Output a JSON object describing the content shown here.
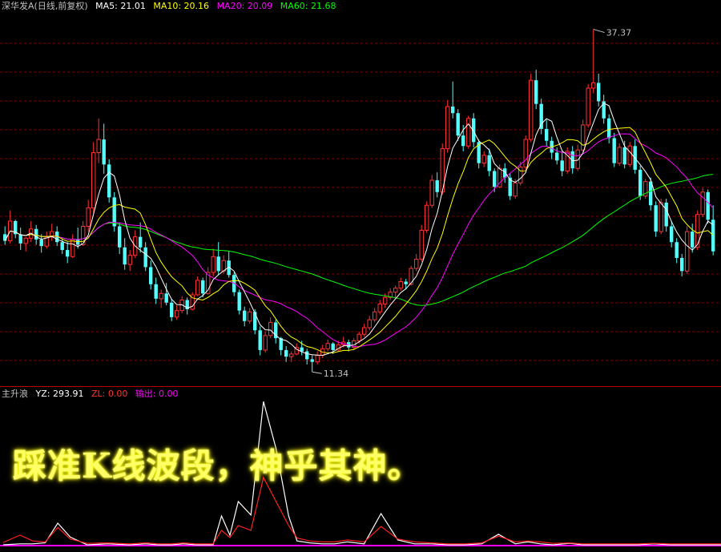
{
  "header": {
    "stock_name": "深华发A",
    "period_label": "(日线,前复权)",
    "ma5": "MA5: 21.01",
    "ma10": "MA10: 20.16",
    "ma20": "MA20: 20.09",
    "ma60": "MA60: 21.68"
  },
  "indicator_header": {
    "name": "主升浪",
    "yz": "YZ: 293.91",
    "zl": "ZL: 0.00",
    "out": "输出: 0.00"
  },
  "caption": "踩准K线波段，神乎其神。",
  "colors": {
    "up": "#ff3232",
    "down": "#54fcfc",
    "ma5": "#ffffff",
    "ma10": "#ffff00",
    "ma20": "#ff00ff",
    "ma60": "#00ff00",
    "grid": "#7a0000",
    "separator": "#b40000",
    "text": "#c0c0c0"
  },
  "chart_data": [
    {
      "type": "candlestick",
      "title": "深华发A (日线,前复权)",
      "price_range": [
        10.5,
        38.5
      ],
      "annotations": {
        "high": "37.37",
        "low": "11.34"
      },
      "candles": [
        [
          21.8,
          22.4,
          21.0,
          21.3
        ],
        [
          21.3,
          23.6,
          21.1,
          22.8
        ],
        [
          22.8,
          22.9,
          21.5,
          21.8
        ],
        [
          21.8,
          22.3,
          20.6,
          21.1
        ],
        [
          21.1,
          21.6,
          20.5,
          21.5
        ],
        [
          21.5,
          22.8,
          21.2,
          22.2
        ],
        [
          22.2,
          22.5,
          21.0,
          21.4
        ],
        [
          21.4,
          21.8,
          20.4,
          20.9
        ],
        [
          20.9,
          22.0,
          20.7,
          21.6
        ],
        [
          21.6,
          22.6,
          21.3,
          22.0
        ],
        [
          22.0,
          22.4,
          20.9,
          21.2
        ],
        [
          21.2,
          21.5,
          20.3,
          20.6
        ],
        [
          20.6,
          21.2,
          19.6,
          20.1
        ],
        [
          20.1,
          21.8,
          20.0,
          21.4
        ],
        [
          21.4,
          22.3,
          20.7,
          21.0
        ],
        [
          21.0,
          22.8,
          20.9,
          22.4
        ],
        [
          22.4,
          24.4,
          22.0,
          23.8
        ],
        [
          23.8,
          28.8,
          23.4,
          28.0
        ],
        [
          28.0,
          30.6,
          27.2,
          29.0
        ],
        [
          29.0,
          30.2,
          26.4,
          27.1
        ],
        [
          27.1,
          27.5,
          24.2,
          24.6
        ],
        [
          24.6,
          25.0,
          22.0,
          22.4
        ],
        [
          22.4,
          22.7,
          20.3,
          20.8
        ],
        [
          20.8,
          21.5,
          19.1,
          19.5
        ],
        [
          19.5,
          20.6,
          19.0,
          20.2
        ],
        [
          20.2,
          22.1,
          20.0,
          21.6
        ],
        [
          21.6,
          22.7,
          20.4,
          20.8
        ],
        [
          20.8,
          21.2,
          19.0,
          19.3
        ],
        [
          19.3,
          19.8,
          17.6,
          18.0
        ],
        [
          18.0,
          18.5,
          16.5,
          16.9
        ],
        [
          16.9,
          17.6,
          16.2,
          17.3
        ],
        [
          17.3,
          18.1,
          16.4,
          16.6
        ],
        [
          16.6,
          16.9,
          15.2,
          15.5
        ],
        [
          15.5,
          16.4,
          15.3,
          16.0
        ],
        [
          16.0,
          17.1,
          15.8,
          16.8
        ],
        [
          16.8,
          17.0,
          15.7,
          16.1
        ],
        [
          16.1,
          17.4,
          16.0,
          17.2
        ],
        [
          17.2,
          18.6,
          17.1,
          18.3
        ],
        [
          18.3,
          18.5,
          17.0,
          17.3
        ],
        [
          17.3,
          19.3,
          17.2,
          18.9
        ],
        [
          18.9,
          20.7,
          18.6,
          20.1
        ],
        [
          20.1,
          21.2,
          18.7,
          19.0
        ],
        [
          19.0,
          20.2,
          18.8,
          19.8
        ],
        [
          19.8,
          20.5,
          18.5,
          18.7
        ],
        [
          18.7,
          18.9,
          17.1,
          17.4
        ],
        [
          17.4,
          17.6,
          15.7,
          16.0
        ],
        [
          16.0,
          16.3,
          14.8,
          15.2
        ],
        [
          15.2,
          16.2,
          15.0,
          15.9
        ],
        [
          15.9,
          16.1,
          14.2,
          14.5
        ],
        [
          14.5,
          14.8,
          12.6,
          13.0
        ],
        [
          13.0,
          14.4,
          12.8,
          14.1
        ],
        [
          14.1,
          15.5,
          13.9,
          15.1
        ],
        [
          15.1,
          15.3,
          13.5,
          13.9
        ],
        [
          13.9,
          14.0,
          12.6,
          13.0
        ],
        [
          13.0,
          13.3,
          12.1,
          12.5
        ],
        [
          12.5,
          12.9,
          12.1,
          12.7
        ],
        [
          12.7,
          13.5,
          12.6,
          13.2
        ],
        [
          13.2,
          13.7,
          12.6,
          12.9
        ],
        [
          12.9,
          13.1,
          11.9,
          12.3
        ],
        [
          12.3,
          12.6,
          11.34,
          12.1
        ],
        [
          12.1,
          12.9,
          11.9,
          12.6
        ],
        [
          12.6,
          13.4,
          12.4,
          13.1
        ],
        [
          13.1,
          13.8,
          12.9,
          13.5
        ],
        [
          13.5,
          13.6,
          12.7,
          13.0
        ],
        [
          13.0,
          13.7,
          12.9,
          13.4
        ],
        [
          13.4,
          14.0,
          13.2,
          13.6
        ],
        [
          13.6,
          13.8,
          12.9,
          13.2
        ],
        [
          13.2,
          13.9,
          13.0,
          13.7
        ],
        [
          13.7,
          14.4,
          13.5,
          14.2
        ],
        [
          14.2,
          15.0,
          14.0,
          14.7
        ],
        [
          14.7,
          15.6,
          14.5,
          15.3
        ],
        [
          15.3,
          16.2,
          15.1,
          15.9
        ],
        [
          15.9,
          16.8,
          15.7,
          16.5
        ],
        [
          16.5,
          17.3,
          16.2,
          17.0
        ],
        [
          17.0,
          17.7,
          16.8,
          17.4
        ],
        [
          17.4,
          17.9,
          17.0,
          17.7
        ],
        [
          17.7,
          18.5,
          17.5,
          18.2
        ],
        [
          18.2,
          18.4,
          17.6,
          18.0
        ],
        [
          18.0,
          19.4,
          17.9,
          19.2
        ],
        [
          19.2,
          20.3,
          19.0,
          19.9
        ],
        [
          19.9,
          22.5,
          19.7,
          22.1
        ],
        [
          22.1,
          24.3,
          21.9,
          24.0
        ],
        [
          24.0,
          26.3,
          23.8,
          25.9
        ],
        [
          25.9,
          26.5,
          24.6,
          25.0
        ],
        [
          25.0,
          28.7,
          24.8,
          28.3
        ],
        [
          28.3,
          32.0,
          28.0,
          31.5
        ],
        [
          31.5,
          33.4,
          30.6,
          31.0
        ],
        [
          31.0,
          31.3,
          28.9,
          29.3
        ],
        [
          29.3,
          30.1,
          28.1,
          28.5
        ],
        [
          28.5,
          30.8,
          28.3,
          30.6
        ],
        [
          30.6,
          31.0,
          28.4,
          28.8
        ],
        [
          28.8,
          29.0,
          26.8,
          27.2
        ],
        [
          27.2,
          28.1,
          26.9,
          27.8
        ],
        [
          27.8,
          28.3,
          26.2,
          26.6
        ],
        [
          26.6,
          26.8,
          25.0,
          25.4
        ],
        [
          25.4,
          27.1,
          25.3,
          26.8
        ],
        [
          26.8,
          27.2,
          25.7,
          26.1
        ],
        [
          26.1,
          26.4,
          24.4,
          24.7
        ],
        [
          24.7,
          26.0,
          24.5,
          25.7
        ],
        [
          25.7,
          27.3,
          25.5,
          26.9
        ],
        [
          26.9,
          29.3,
          26.7,
          29.0
        ],
        [
          29.0,
          34.0,
          28.8,
          33.5
        ],
        [
          33.5,
          34.3,
          31.3,
          31.7
        ],
        [
          31.7,
          32.1,
          29.4,
          29.8
        ],
        [
          29.8,
          30.5,
          28.5,
          28.9
        ],
        [
          28.9,
          29.2,
          27.5,
          28.0
        ],
        [
          28.0,
          28.4,
          27.1,
          27.4
        ],
        [
          27.4,
          28.1,
          26.2,
          26.6
        ],
        [
          26.6,
          28.4,
          26.4,
          28.1
        ],
        [
          28.1,
          28.5,
          26.4,
          26.8
        ],
        [
          26.8,
          28.6,
          26.6,
          28.2
        ],
        [
          28.2,
          30.5,
          28.0,
          30.1
        ],
        [
          30.1,
          33.2,
          29.9,
          32.9
        ],
        [
          32.9,
          37.37,
          32.5,
          33.3
        ],
        [
          33.3,
          34.0,
          31.5,
          31.9
        ],
        [
          31.9,
          32.4,
          30.2,
          30.6
        ],
        [
          30.6,
          30.9,
          28.7,
          29.1
        ],
        [
          29.1,
          29.5,
          26.9,
          27.2
        ],
        [
          27.2,
          28.7,
          27.0,
          28.4
        ],
        [
          28.4,
          28.9,
          26.8,
          27.1
        ],
        [
          27.1,
          28.8,
          26.9,
          28.5
        ],
        [
          28.5,
          29.0,
          26.4,
          26.7
        ],
        [
          26.7,
          27.0,
          24.4,
          24.7
        ],
        [
          24.7,
          26.0,
          24.5,
          25.8
        ],
        [
          25.8,
          26.1,
          23.6,
          24.0
        ],
        [
          24.0,
          24.3,
          21.6,
          22.0
        ],
        [
          22.0,
          24.5,
          21.8,
          24.2
        ],
        [
          24.2,
          24.5,
          22.0,
          22.4
        ],
        [
          22.4,
          22.8,
          20.8,
          21.2
        ],
        [
          21.2,
          21.5,
          19.6,
          20.0
        ],
        [
          20.0,
          20.3,
          18.6,
          19.0
        ],
        [
          19.0,
          22.4,
          18.8,
          22.0
        ],
        [
          22.0,
          22.6,
          20.4,
          20.8
        ],
        [
          20.8,
          23.6,
          20.6,
          23.3
        ],
        [
          23.3,
          25.3,
          23.1,
          25.0
        ],
        [
          25.0,
          25.2,
          22.6,
          22.9
        ],
        [
          22.9,
          24.0,
          20.2,
          20.5
        ]
      ]
    },
    {
      "type": "line",
      "title": "主升浪",
      "y_range": [
        0,
        300
      ],
      "x": [
        0,
        8,
        14,
        20,
        26,
        32,
        40,
        50,
        60,
        68,
        74,
        80,
        86,
        92,
        100,
        104,
        108,
        112,
        118,
        124,
        130,
        136,
        140,
        146,
        152,
        158,
        164,
        172,
        180,
        188,
        196,
        204,
        212,
        220,
        228,
        236,
        244,
        250,
        256,
        262,
        270,
        276,
        282,
        290,
        296,
        302,
        310,
        318,
        326,
        334,
        342
      ],
      "series": [
        {
          "name": "YZ",
          "color": "#ffffff",
          "values": [
            0,
            2,
            2,
            4,
            45,
            16,
            0,
            2,
            0,
            2,
            0,
            0,
            2,
            0,
            0,
            60,
            20,
            90,
            62,
            298,
            200,
            60,
            8,
            4,
            2,
            2,
            6,
            2,
            65,
            10,
            2,
            2,
            0,
            0,
            2,
            22,
            2,
            6,
            2,
            0,
            3,
            0,
            0,
            0,
            0,
            0,
            2,
            0,
            0,
            0,
            0
          ]
        },
        {
          "name": "ZL",
          "color": "#ff2020",
          "values": [
            5,
            20,
            8,
            6,
            36,
            12,
            3,
            4,
            2,
            4,
            2,
            2,
            4,
            2,
            2,
            30,
            15,
            40,
            30,
            140,
            90,
            40,
            14,
            8,
            6,
            6,
            10,
            6,
            38,
            12,
            6,
            4,
            2,
            2,
            4,
            18,
            6,
            8,
            6,
            3,
            4,
            2,
            2,
            2,
            2,
            2,
            3,
            2,
            2,
            2,
            2
          ]
        },
        {
          "name": "输出",
          "color": "#ff00ff",
          "values": [
            0,
            0,
            0,
            0,
            0,
            0,
            0,
            0,
            0,
            0,
            0,
            0,
            0,
            0,
            0,
            0,
            0,
            0,
            0,
            0,
            0,
            0,
            0,
            0,
            0,
            0,
            0,
            0,
            0,
            0,
            0,
            0,
            0,
            0,
            0,
            0,
            0,
            0,
            0,
            0,
            0,
            0,
            0,
            0,
            0,
            0,
            0,
            0,
            0,
            0,
            0
          ]
        }
      ]
    }
  ]
}
